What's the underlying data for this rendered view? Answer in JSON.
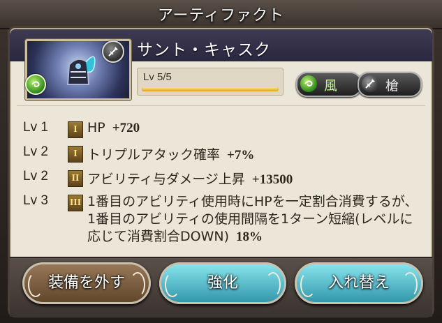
{
  "window": {
    "title": "アーティファクト"
  },
  "artifact": {
    "name": "サント・キャスク",
    "level_text": "Lv 5/5",
    "level_progress": 1.0,
    "element": {
      "label": "風",
      "icon": "wind-element-icon",
      "color": "#3fa82a"
    },
    "weapon": {
      "label": "槍",
      "icon": "spear-icon"
    },
    "portrait_icon": "helmet-portrait"
  },
  "skills": [
    {
      "level": "Lv 1",
      "rank": "I",
      "text": "HP",
      "value": "+720"
    },
    {
      "level": "Lv 2",
      "rank": "I",
      "text": "トリプルアタック確率",
      "value": "+7%"
    },
    {
      "level": "Lv 2",
      "rank": "II",
      "text": "アビリティ与ダメージ上昇",
      "value": "+13500"
    },
    {
      "level": "Lv 3",
      "rank": "III",
      "text": "1番目のアビリティ使用時にHPを一定割合消費するが、1番目のアビリティの使用間隔を1ターン短縮(レベルに応じて消費割合DOWN)",
      "value": "18%"
    }
  ],
  "buttons": {
    "unequip": "装備を外す",
    "enhance": "強化",
    "replace": "入れ替え"
  },
  "colors": {
    "accent_teal": "#5cc6d4",
    "level_bar": "#f0b840",
    "panel": "#ece6d8"
  }
}
